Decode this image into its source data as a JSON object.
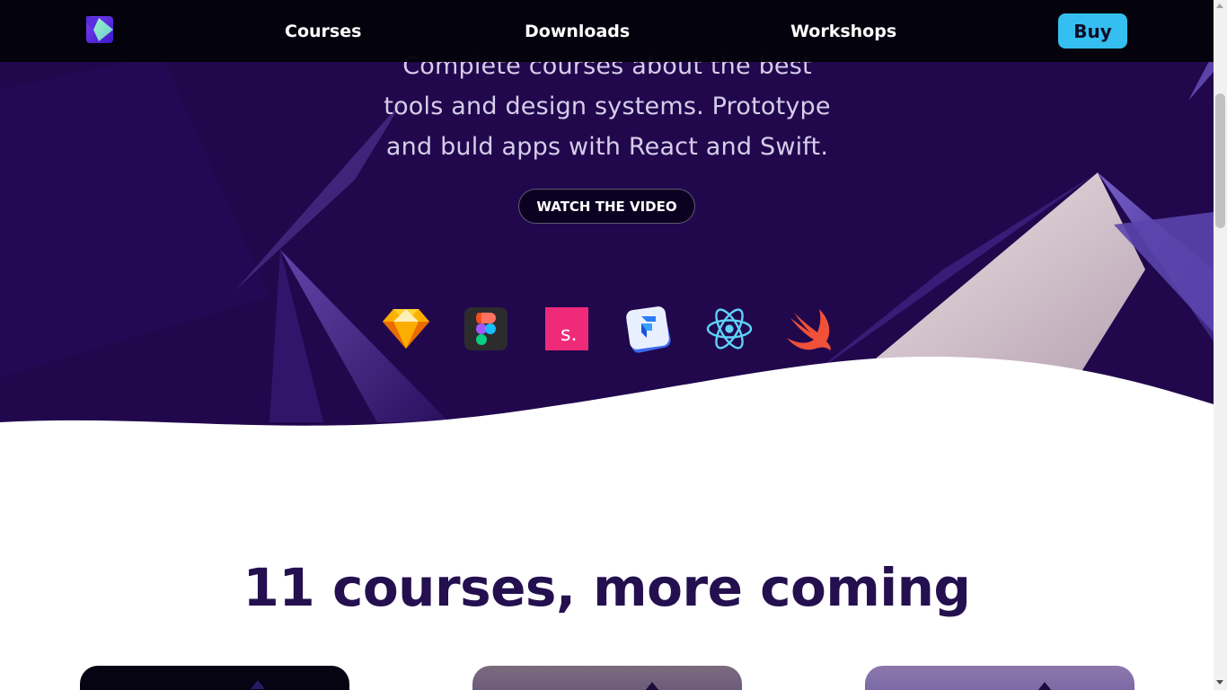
{
  "nav": {
    "logo_icon": "brand-logo-icon",
    "links": [
      "Courses",
      "Downloads",
      "Workshops"
    ],
    "buy_label": "Buy"
  },
  "hero": {
    "line1": "Complete courses about the best",
    "line2": "tools and design systems. Prototype",
    "line3": "and buld apps with React and Swift.",
    "cta_label": "WATCH THE VIDEO",
    "tool_icons": [
      "sketch-icon",
      "figma-icon",
      "studio-icon",
      "framer-icon",
      "react-icon",
      "swift-icon"
    ],
    "studio_letter": "s."
  },
  "courses": {
    "title": "11 courses, more coming"
  },
  "colors": {
    "hero_bg": "#21084d",
    "nav_bg": "#03020a",
    "accent": "#34bff0",
    "title": "#24104f"
  }
}
